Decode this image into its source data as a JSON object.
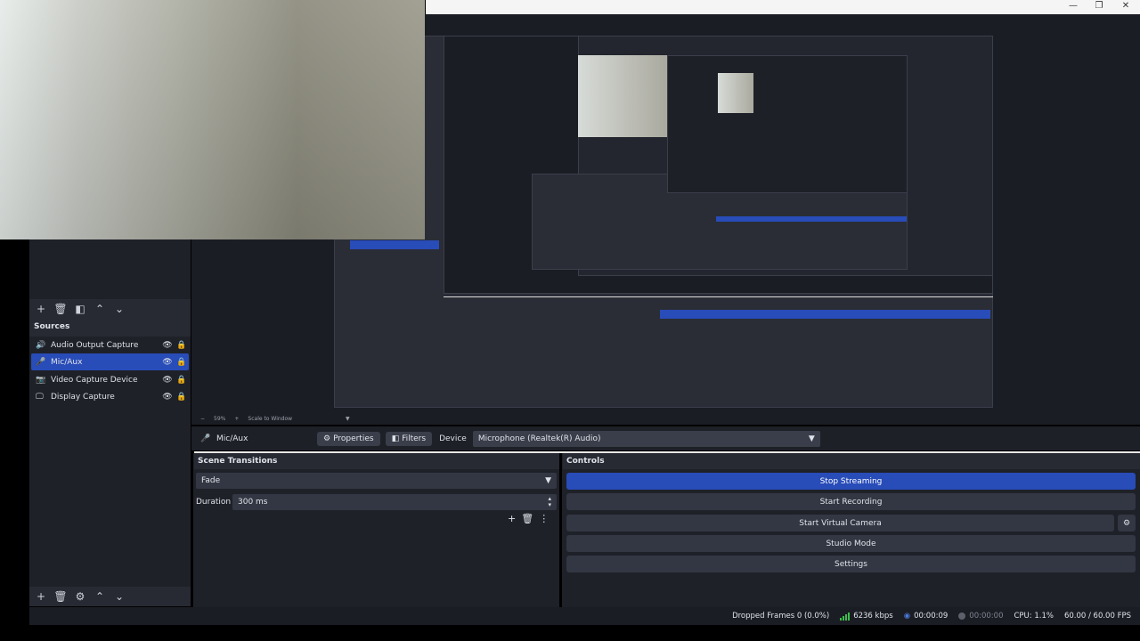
{
  "window": {
    "minimize": "—",
    "restore": "❐",
    "close": "✕"
  },
  "zoom_bar": {
    "minus": "−",
    "zoom": "59%",
    "plus": "+",
    "mode": "Scale to Window"
  },
  "sources": {
    "title": "Sources",
    "items": [
      {
        "label": "Audio Output Capture",
        "icon": "speaker-icon",
        "glyph": "🔊"
      },
      {
        "label": "Mic/Aux",
        "icon": "microphone-icon",
        "glyph": "🎤"
      },
      {
        "label": "Video Capture Device",
        "icon": "camera-icon",
        "glyph": "📷"
      },
      {
        "label": "Display Capture",
        "icon": "monitor-icon",
        "glyph": "🖵"
      }
    ],
    "selected_index": 1
  },
  "context_bar": {
    "source_name": "Mic/Aux",
    "properties_label": "Properties",
    "filters_label": "Filters",
    "device_label": "Device",
    "device_value": "Microphone (Realtek(R) Audio)"
  },
  "scene_transitions": {
    "title": "Scene Transitions",
    "transition": "Fade",
    "duration_label": "Duration",
    "duration_value": "300 ms"
  },
  "controls": {
    "title": "Controls",
    "stop_streaming": "Stop Streaming",
    "start_recording": "Start Recording",
    "start_virtual_camera": "Start Virtual Camera",
    "studio_mode": "Studio Mode",
    "settings": "Settings"
  },
  "status": {
    "dropped_frames": "Dropped Frames 0 (0.0%)",
    "bitrate": "6236 kbps",
    "stream_time": "00:00:09",
    "record_time": "00:00:00",
    "cpu": "CPU: 1.1%",
    "fps": "60.00 / 60.00 FPS"
  },
  "colors": {
    "accent": "#284cb8",
    "bitrate_green": "#3dbd4d",
    "stream_blue": "#4a78d8"
  }
}
